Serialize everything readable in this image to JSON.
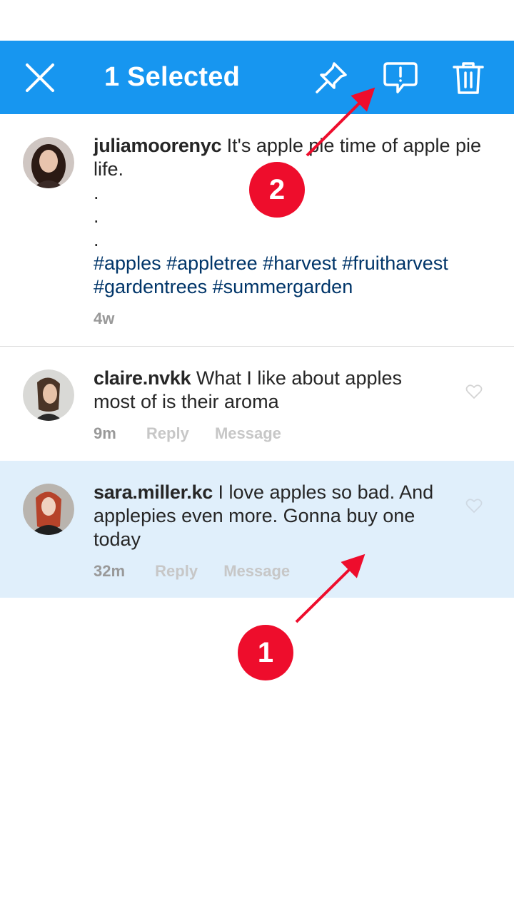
{
  "action_bar": {
    "title": "1 Selected",
    "background": "#1796f0",
    "icons": [
      "close-icon",
      "pin-icon",
      "report-icon",
      "trash-icon"
    ]
  },
  "post": {
    "username": "juliamoorenyc",
    "caption": "It's apple pie time of apple pie life.",
    "dots": [
      ".",
      ".",
      "."
    ],
    "hashtags_line1": "#apples #appletree #harvest #fruitharvest",
    "hashtags_line2": "#gardentrees #summergarden",
    "time": "4w"
  },
  "comments": [
    {
      "username": "claire.nvkk",
      "text_line1": "What I like about apples",
      "text_line2": "most of is their aroma",
      "time": "9m",
      "reply": "Reply",
      "message": "Message",
      "selected": false
    },
    {
      "username": "sara.miller.kc",
      "text_line1": "I love apples so bad. And",
      "text_line2": "applepies even more. Gonna buy one",
      "text_line3": "today",
      "time": "32m",
      "reply": "Reply",
      "message": "Message",
      "selected": true
    }
  ],
  "annotations": [
    {
      "label": "1"
    },
    {
      "label": "2"
    }
  ],
  "colors": {
    "accent": "#1796f0",
    "selected_row": "#e0effb",
    "annotation_red": "#ee0d2c",
    "hashtag": "#003569"
  }
}
